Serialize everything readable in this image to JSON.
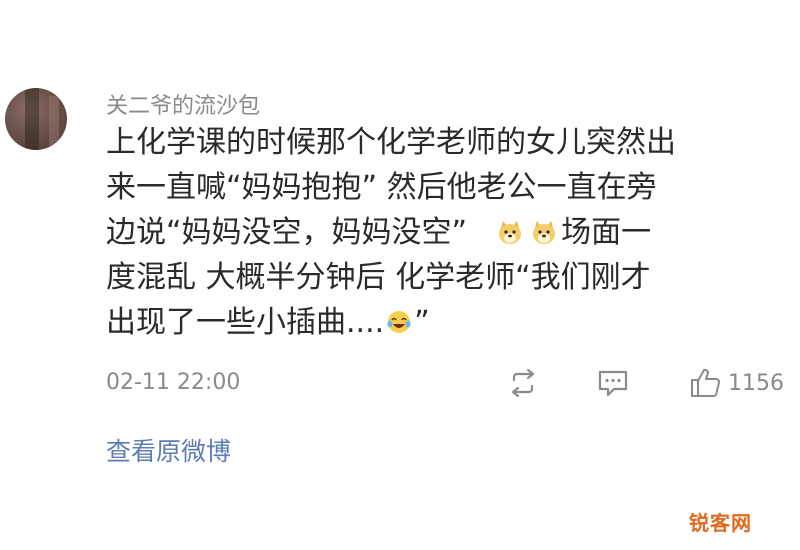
{
  "comment": {
    "username": "关二爷的流沙包",
    "lines": [
      "上化学课的时候那个化学老师的女儿突然出",
      "来一直喊“妈妈抱抱” 然后他老公一直在旁",
      "边说“妈妈没空，妈妈没空”",
      "场面一",
      "度混乱 大概半分钟后 化学老师“我们刚才",
      "出现了一些小插曲....",
      "”"
    ],
    "timestamp": "02-11 22:00",
    "like_count": "1156",
    "view_link": "查看原微博"
  },
  "icons": {
    "repost": "repost-icon",
    "comment": "comment-icon",
    "like": "thumbs-up-icon",
    "emoji_doge": "doge-emoji-icon",
    "emoji_cry_laugh": "laughing-crying-emoji-icon"
  },
  "colors": {
    "meta_text": "#8a8a8a",
    "body_text": "#2a2a2a",
    "link": "#5d7db4",
    "watermark": "#e06a1e"
  },
  "watermark": {
    "text": "锐客网"
  }
}
